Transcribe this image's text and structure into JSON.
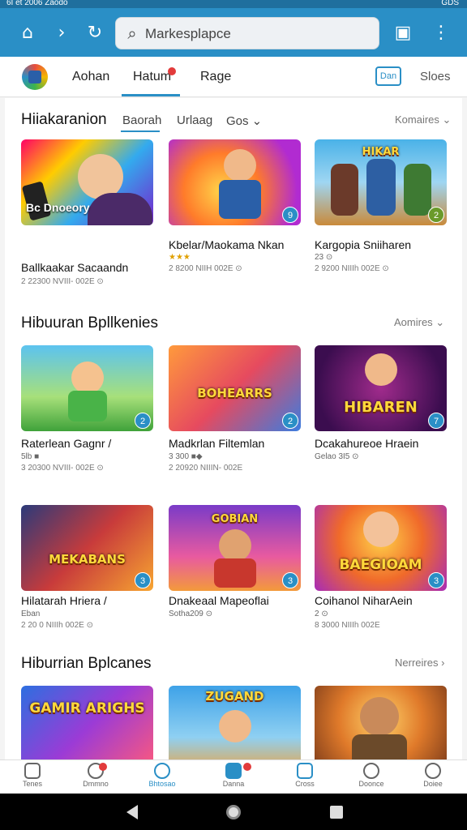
{
  "status": {
    "left": "6I et 2006 Zaodo",
    "right": "GDS"
  },
  "topbar": {
    "home_icon": "home-icon",
    "forward_icon": "chevron-right-icon",
    "refresh_icon": "refresh-icon",
    "search_placeholder": "Markesplapce",
    "cast_icon": "cast-icon",
    "menu_icon": "more-vert-icon"
  },
  "tabs": {
    "items": [
      "Aohan",
      "Hatum",
      "Rage"
    ],
    "button_label": "Dan",
    "right_label": "Sloes"
  },
  "sections": [
    {
      "title": "Hiiakaranion",
      "subtabs": [
        "Baorah",
        "Urlaag",
        "Gos ⌄"
      ],
      "see_more": "Komaires ⌄",
      "cards": [
        {
          "art": "",
          "overlay": "Bc Dnoeory",
          "badge": "",
          "title": "Ballkaakar Sacaandn",
          "sub": "",
          "meta": "2 22300 NVIII- 002E ⊙"
        },
        {
          "art": "",
          "overlay": "",
          "badge": "9",
          "title": "Kbelar/Maokama Nkan",
          "sub": "",
          "meta": "2 8200 NIIH 002E ⊙"
        },
        {
          "art": "HIKAR",
          "overlay": "",
          "badge": "2",
          "title": "Kargopia Sniiharen",
          "sub": "23 ⊙",
          "meta": "2 9200 NIIIh 002E ⊙"
        }
      ]
    },
    {
      "title": "Hibuuran Bpllkenies",
      "subtabs": [],
      "see_more": "Aomires ⌄",
      "cards": [
        {
          "art": "",
          "overlay": "",
          "badge": "2",
          "title": "Raterlean Gagnr /",
          "sub": "5lb ■",
          "meta": "3 20300 NVIII- 002E ⊙"
        },
        {
          "art": "BOHEARRS",
          "overlay": "",
          "badge": "2",
          "title": "Madkrlan Filtemlan",
          "sub": "3 300 ■◆",
          "meta": "2 20920 NIIIN- 002E"
        },
        {
          "art": "HIBAREN",
          "overlay": "",
          "badge": "7",
          "title": "Dcakahureoe Hraein",
          "sub": "Gelao 3I5 ⊙",
          "meta": ""
        }
      ]
    },
    {
      "title": "",
      "subtabs": [],
      "see_more": "",
      "cards": [
        {
          "art": "MEKABANS",
          "overlay": "",
          "badge": "3",
          "title": "Hilatarah Hriera /",
          "sub": "Eban",
          "meta": "2 20 0 NIIIh 002E ⊙"
        },
        {
          "art": "GOBIAN",
          "overlay": "",
          "badge": "3",
          "title": "Dnakeaal Mapeoflai",
          "sub": "Sotha209 ⊙",
          "meta": ""
        },
        {
          "art": "BAEGIOAM",
          "overlay": "",
          "badge": "3",
          "title": "Coihanol NiharAein",
          "sub": "2 ⊙",
          "meta": "8 3000 NIIIh 002E"
        }
      ]
    },
    {
      "title": "Hiburrian Bplcanes",
      "subtabs": [],
      "see_more": "Nerreires ›",
      "cards": [
        {
          "art": "GAMIR ARIGHS",
          "overlay": "",
          "badge": "",
          "title": "",
          "sub": "",
          "meta": ""
        },
        {
          "art": "ZUGAND",
          "overlay": "",
          "badge": "",
          "title": "",
          "sub": "",
          "meta": ""
        },
        {
          "art": "",
          "overlay": "",
          "badge": "",
          "title": "",
          "sub": "",
          "meta": ""
        }
      ]
    }
  ],
  "bottom_nav": [
    "Tenes",
    "Dmmno",
    "Bhtosao",
    "Danna",
    "Cross",
    "Doonce",
    "Doiee"
  ],
  "colors": {
    "accent": "#2a8fc6",
    "badge_red": "#e23b3b"
  }
}
